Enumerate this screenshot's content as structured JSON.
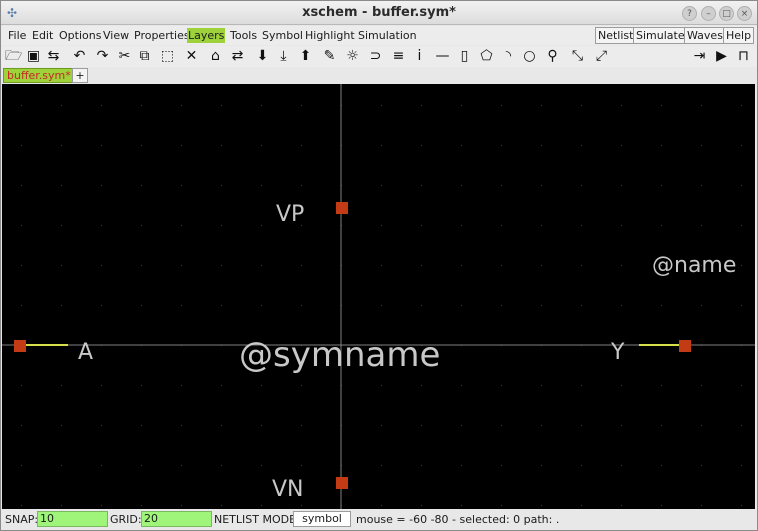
{
  "window": {
    "title": "xschem - buffer.sym*"
  },
  "menubar": {
    "items": [
      "File",
      "Edit",
      "Options",
      "View",
      "Properties",
      "Layers",
      "Tools",
      "Symbol",
      "Highlight",
      "Simulation"
    ],
    "active_item": "Layers",
    "right_buttons": [
      "Netlist",
      "Simulate",
      "Waves",
      "Help"
    ]
  },
  "toolbar": {
    "icons": [
      "open-folder-icon",
      "save-icon",
      "reload-icon",
      "undo-icon",
      "redo-icon",
      "cut-icon",
      "copy-icon",
      "paste-icon",
      "delete-icon",
      "place-symbol-icon",
      "swap-icon",
      "push-down-icon",
      "descend-icon",
      "pop-up-icon",
      "pen-icon",
      "highlight-icon",
      "netlist-icon",
      "text-icon",
      "pin-icon",
      "line-icon",
      "rect-icon",
      "polygon-icon",
      "arc-icon",
      "circle-icon",
      "zoom-icon",
      "zoom-in-icon",
      "zoom-out-icon",
      "insert-icon",
      "run-icon",
      "waveform-icon"
    ]
  },
  "tabs": {
    "items": [
      "buffer.sym*"
    ],
    "add_label": "+"
  },
  "schematic": {
    "labels": {
      "vp": "VP",
      "vn": "VN",
      "a": "A",
      "y": "Y",
      "symname": "@symname",
      "name": "@name"
    },
    "colors": {
      "background": "#000000",
      "pin": "#c23b14",
      "wire": "#d6e04a",
      "axis": "#808080",
      "text": "#c8c8c8"
    }
  },
  "status": {
    "snap_label": "SNAP:",
    "snap_value": "10",
    "grid_label": "GRID:",
    "grid_value": "20",
    "netlist_mode_label": "NETLIST MODE:",
    "netlist_mode_value": "symbol",
    "info": "mouse = -60 -80 - selected: 0 path: ."
  }
}
